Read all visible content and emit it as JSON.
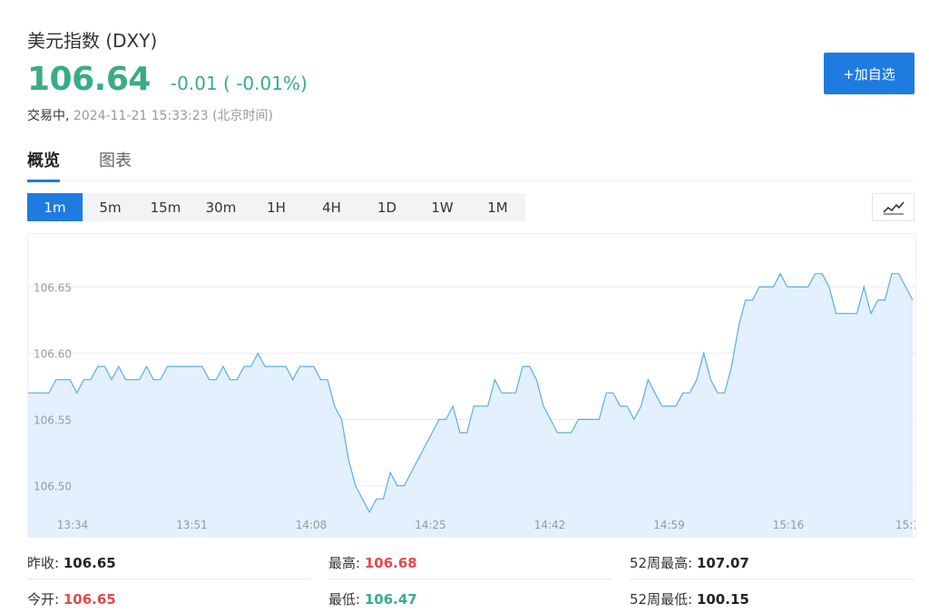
{
  "header": {
    "title": "美元指数 (DXY)",
    "price": "106.64",
    "change": "-0.01 ( -0.01%)",
    "status": "交易中,",
    "datetime": "2024-11-21 15:33:23",
    "timezone": "(北京时间)",
    "watch_button": "+加自选"
  },
  "tabs": [
    {
      "label": "概览",
      "active": true
    },
    {
      "label": "图表",
      "active": false
    }
  ],
  "intervals": [
    {
      "label": "1m",
      "active": true
    },
    {
      "label": "5m",
      "active": false
    },
    {
      "label": "15m",
      "active": false
    },
    {
      "label": "30m",
      "active": false
    },
    {
      "label": "1H",
      "active": false
    },
    {
      "label": "4H",
      "active": false
    },
    {
      "label": "1D",
      "active": false
    },
    {
      "label": "1W",
      "active": false
    },
    {
      "label": "1M",
      "active": false
    }
  ],
  "chart_type_icon": "line-chart-icon",
  "colors": {
    "accent": "#1e7be0",
    "down": "#3aac83",
    "up": "#e5484d",
    "line": "#5aaee8",
    "area": "#e3f0fd"
  },
  "stats": {
    "prev_close": {
      "label": "昨收:",
      "value": "106.65"
    },
    "high": {
      "label": "最高:",
      "value": "106.68"
    },
    "high_52w": {
      "label": "52周最高:",
      "value": "107.07"
    },
    "open": {
      "label": "今开:",
      "value": "106.65"
    },
    "low": {
      "label": "最低:",
      "value": "106.47"
    },
    "low_52w": {
      "label": "52周最低:",
      "value": "100.15"
    }
  },
  "chart_data": {
    "type": "area",
    "title": "",
    "xlabel": "",
    "ylabel": "",
    "ylim": [
      106.46,
      106.69
    ],
    "y_ticks": [
      "106.65",
      "106.60",
      "106.55",
      "106.50"
    ],
    "x_ticks": [
      "13:34",
      "13:51",
      "14:08",
      "14:25",
      "14:42",
      "14:59",
      "15:16",
      "15:3"
    ],
    "grid": true,
    "series": [
      {
        "values": [
          106.57,
          106.57,
          106.57,
          106.57,
          106.58,
          106.58,
          106.58,
          106.57,
          106.58,
          106.58,
          106.59,
          106.59,
          106.58,
          106.59,
          106.58,
          106.58,
          106.58,
          106.59,
          106.58,
          106.58,
          106.59,
          106.59,
          106.59,
          106.59,
          106.59,
          106.59,
          106.58,
          106.58,
          106.59,
          106.58,
          106.58,
          106.59,
          106.59,
          106.6,
          106.59,
          106.59,
          106.59,
          106.59,
          106.58,
          106.59,
          106.59,
          106.59,
          106.58,
          106.58,
          106.56,
          106.55,
          106.52,
          106.5,
          106.49,
          106.48,
          106.49,
          106.49,
          106.51,
          106.5,
          106.5,
          106.51,
          106.52,
          106.53,
          106.54,
          106.55,
          106.55,
          106.56,
          106.54,
          106.54,
          106.56,
          106.56,
          106.56,
          106.58,
          106.57,
          106.57,
          106.57,
          106.59,
          106.59,
          106.58,
          106.56,
          106.55,
          106.54,
          106.54,
          106.54,
          106.55,
          106.55,
          106.55,
          106.55,
          106.57,
          106.57,
          106.56,
          106.56,
          106.55,
          106.56,
          106.58,
          106.57,
          106.56,
          106.56,
          106.56,
          106.57,
          106.57,
          106.58,
          106.6,
          106.58,
          106.57,
          106.57,
          106.59,
          106.62,
          106.64,
          106.64,
          106.65,
          106.65,
          106.65,
          106.66,
          106.65,
          106.65,
          106.65,
          106.65,
          106.66,
          106.66,
          106.65,
          106.63,
          106.63,
          106.63,
          106.63,
          106.65,
          106.63,
          106.64,
          106.64,
          106.66,
          106.66,
          106.65,
          106.64
        ]
      }
    ]
  }
}
